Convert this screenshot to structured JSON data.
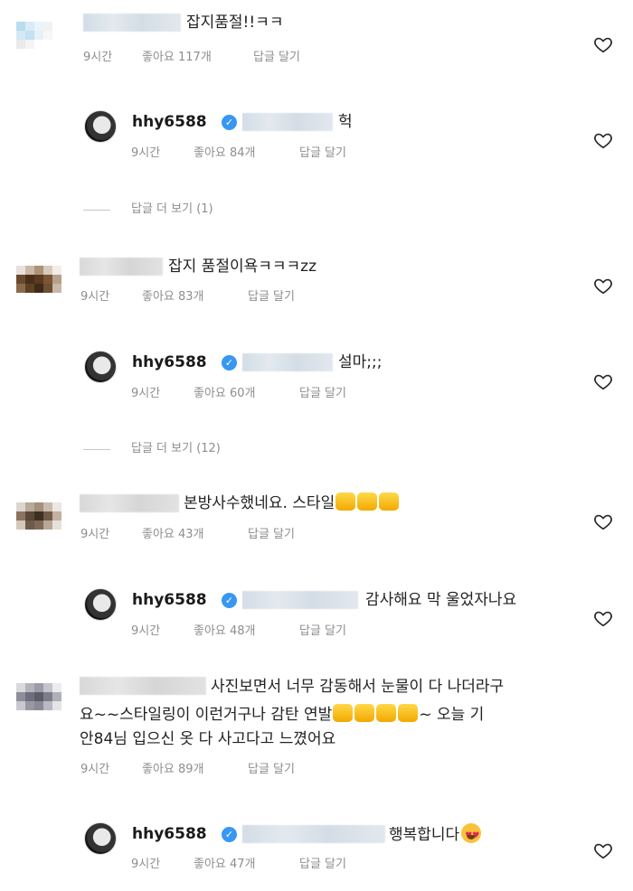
{
  "comments": [
    {
      "text": "잡지품절!!ㅋㅋ",
      "time": "9시간",
      "likes": "좋아요 117개",
      "reply": "답글 달기",
      "avatar_colors": [
        "#b9dcf1",
        "#d8ebf7",
        "#e9f4fb",
        "#f2f2f2",
        "#ffffff",
        "#d4e9f6",
        "#c5e1f3",
        "#e6f1f8",
        "#f7f7f7",
        "#ffffff",
        "#eaeaea",
        "#f4f4f4",
        "#ffffff",
        "#ffffff",
        "#ffffff"
      ]
    },
    {
      "username": "hhy6588",
      "text": "헉",
      "time": "9시간",
      "likes": "좋아요 84개",
      "reply": "답글 달기"
    },
    {
      "text": "잡지 품절이욕ㅋㅋㅋzz",
      "time": "9시간",
      "likes": "좋아요 83개",
      "reply": "답글 달기",
      "avatar_colors": [
        "#e8e2dc",
        "#cbb9a6",
        "#ad937a",
        "#d9cabb",
        "#f2eee9",
        "#6b4a2c",
        "#4a2f18",
        "#5a3a20",
        "#7a5636",
        "#b5a08a",
        "#8a6a4a",
        "#5c4126",
        "#3f2a17",
        "#6e4f33",
        "#c9b8a5"
      ]
    },
    {
      "username": "hhy6588",
      "text": "설마;;;",
      "time": "9시간",
      "likes": "좋아요 60개",
      "reply": "답글 달기"
    },
    {
      "text": "본방사수했네요. 스타일",
      "time": "9시간",
      "likes": "좋아요 43개",
      "reply": "답글 달기",
      "avatar_colors": [
        "#ddd6cf",
        "#b8a999",
        "#a48f7a",
        "#c9bcaf",
        "#ece7e2",
        "#8a7360",
        "#5b4737",
        "#3e2f23",
        "#705a48",
        "#c2b2a2",
        "#d4c8bb",
        "#6d5a4a",
        "#7f6a58",
        "#b8a898",
        "#e7e1db"
      ]
    },
    {
      "username": "hhy6588",
      "text": "감사해요 막 울었자나요",
      "time": "9시간",
      "likes": "좋아요 48개",
      "reply": "답글 달기"
    },
    {
      "text_lines": [
        "사진보면서 너무 감동해서 눈물이 다 나더라구",
        "요~~스타일링이 이런거구나 감탄 연발",
        "~ 오늘 기",
        "안84님 입으신 옷 다 사고다고 느꼈어요"
      ],
      "time": "9시간",
      "likes": "좋아요 89개",
      "reply": "답글 달기",
      "avatar_colors": [
        "#d9d9de",
        "#b3b3bd",
        "#9c9ca8",
        "#c4c4cc",
        "#ececef",
        "#8e8e9b",
        "#6f6f7c",
        "#5c5c68",
        "#7d7d8a",
        "#b0b0bb",
        "#c8c8d0",
        "#9898a4",
        "#8a8a96",
        "#b9b9c3",
        "#e3e3e8"
      ]
    },
    {
      "username": "hhy6588",
      "text": "행복합니다",
      "time": "9시간",
      "likes": "좋아요 47개",
      "reply": "답글 달기"
    }
  ],
  "view_replies": [
    "답글 더 보기 (1)",
    "답글 더 보기 (12)"
  ],
  "icons": {
    "like": "heart-outline-icon",
    "verified": "verified-badge-icon"
  }
}
